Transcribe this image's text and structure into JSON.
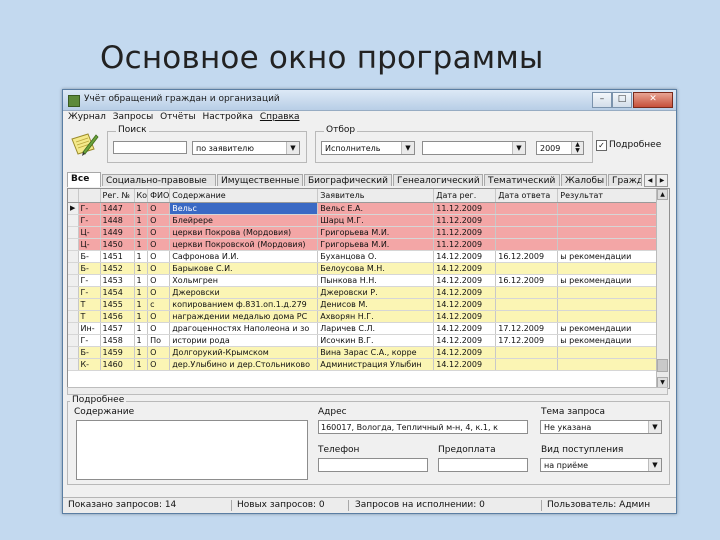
{
  "slide": {
    "title": "Основное окно программы"
  },
  "window": {
    "title": "Учёт обращений граждан и организаций",
    "controls": {
      "minimize": "–",
      "maximize": "□",
      "close": "✕"
    }
  },
  "menu": [
    "Журнал",
    "Запросы",
    "Отчёты",
    "Настройка",
    "Справка"
  ],
  "search": {
    "legend": "Поиск",
    "field_value": "",
    "mode_value": "по заявителю"
  },
  "filter": {
    "legend": "Отбор",
    "field_value": "Исполнитель",
    "value": "",
    "year": "2009",
    "detail_label": "Подробнее",
    "detail_checked": true
  },
  "tabs": [
    "Все",
    "Социально-правовые",
    "Имущественные",
    "Биографический",
    "Генеалогический",
    "Тематический",
    "Жалобы",
    "Граждане"
  ],
  "table": {
    "columns": [
      "",
      "Рег. №",
      "Ко",
      "ФИО",
      "Содержание",
      "Заявитель",
      "Дата рег.",
      "Дата ответа",
      "Результат"
    ],
    "rows": [
      {
        "marker": "▶",
        "c1": "Г-",
        "c2": "1447",
        "c3": "1",
        "c4": "О",
        "c5": "Вельс",
        "c6": "Вельс Е.А.",
        "c7": "11.12.2009",
        "c8": "",
        "c9": "",
        "color": "#f3a6a6"
      },
      {
        "marker": "",
        "c1": "Г-",
        "c2": "1448",
        "c3": "1",
        "c4": "О",
        "c5": "Блейрере",
        "c6": "Шарц М.Г.",
        "c7": "11.12.2009",
        "c8": "",
        "c9": "",
        "color": "#f3a6a6"
      },
      {
        "marker": "",
        "c1": "Ц-",
        "c2": "1449",
        "c3": "1",
        "c4": "О",
        "c5": "церкви Покрова (Мордовия)",
        "c6": "Григорьева М.И.",
        "c7": "11.12.2009",
        "c8": "",
        "c9": "",
        "color": "#f3a6a6"
      },
      {
        "marker": "",
        "c1": "Ц-",
        "c2": "1450",
        "c3": "1",
        "c4": "О",
        "c5": "церкви Покровской (Мордовия)",
        "c6": "Григорьева М.И.",
        "c7": "11.12.2009",
        "c8": "",
        "c9": "",
        "color": "#f3a6a6"
      },
      {
        "marker": "",
        "c1": "Б-",
        "c2": "1451",
        "c3": "1",
        "c4": "О",
        "c5": "Сафронова И.И.",
        "c6": "Буханцова О.",
        "c7": "14.12.2009",
        "c8": "16.12.2009",
        "c9": "ы рекомендации",
        "color": "#ffffff"
      },
      {
        "marker": "",
        "c1": "Б-",
        "c2": "1452",
        "c3": "1",
        "c4": "О",
        "c5": "Барыкове С.И.",
        "c6": "Белоусова М.Н.",
        "c7": "14.12.2009",
        "c8": "",
        "c9": "",
        "color": "#fbf5b4"
      },
      {
        "marker": "",
        "c1": "Г-",
        "c2": "1453",
        "c3": "1",
        "c4": "О",
        "c5": "Хольмгрен",
        "c6": "Пынкова Н.Н.",
        "c7": "14.12.2009",
        "c8": "16.12.2009",
        "c9": "ы рекомендации",
        "color": "#ffffff"
      },
      {
        "marker": "",
        "c1": "Г-",
        "c2": "1454",
        "c3": "1",
        "c4": "О",
        "c5": "Джеровски",
        "c6": "Джеровски Р.",
        "c7": "14.12.2009",
        "c8": "",
        "c9": "",
        "color": "#fbf5b4"
      },
      {
        "marker": "",
        "c1": "Т",
        "c2": "1455",
        "c3": "1",
        "c4": "с",
        "c5": "копированием ф.831.оп.1.д.279",
        "c6": "Денисов М.",
        "c7": "14.12.2009",
        "c8": "",
        "c9": "",
        "color": "#fbf5b4"
      },
      {
        "marker": "",
        "c1": "Т",
        "c2": "1456",
        "c3": "1",
        "c4": "О",
        "c5": "награждении медалью дома РС",
        "c6": "Ахворян Н.Г.",
        "c7": "14.12.2009",
        "c8": "",
        "c9": "",
        "color": "#fbf5b4"
      },
      {
        "marker": "",
        "c1": "Ин-",
        "c2": "1457",
        "c3": "1",
        "c4": "О",
        "c5": "драгоценностях Наполеона и зо",
        "c6": "Ларичев С.Л.",
        "c7": "14.12.2009",
        "c8": "17.12.2009",
        "c9": "ы рекомендации",
        "color": "#ffffff"
      },
      {
        "marker": "",
        "c1": "Г-",
        "c2": "1458",
        "c3": "1",
        "c4": "По",
        "c5": "истории рода",
        "c6": "Исочкин В.Г.",
        "c7": "14.12.2009",
        "c8": "17.12.2009",
        "c9": "ы рекомендации",
        "color": "#ffffff"
      },
      {
        "marker": "",
        "c1": "Б-",
        "c2": "1459",
        "c3": "1",
        "c4": "О",
        "c5": "Долгорукий-Крымском",
        "c6": "Вина Зарас С.А., корре",
        "c7": "14.12.2009",
        "c8": "",
        "c9": "",
        "color": "#fbf5b4"
      },
      {
        "marker": "",
        "c1": "К-",
        "c2": "1460",
        "c3": "1",
        "c4": "О",
        "c5": "дер.Улыбино и дер.Стольниково",
        "c6": "Администрация Улыбин",
        "c7": "14.12.2009",
        "c8": "",
        "c9": "",
        "color": "#fbf5b4"
      }
    ]
  },
  "details": {
    "legend": "Подробнее",
    "content_label": "Содержание",
    "address_label": "Адрес",
    "address_value": "160017, Вологда, Тепличный м-н, 4, к.1, к",
    "phone_label": "Телефон",
    "phone_value": "",
    "prepay_label": "Предоплата",
    "prepay_value": "",
    "topic_label": "Тема запроса",
    "topic_value": "Не указана",
    "receipt_label": "Вид поступления",
    "receipt_value": "на приёме"
  },
  "status": {
    "shown": "Показано запросов: 14",
    "new": "Новых запросов: 0",
    "in_progress": "Запросов на исполнении: 0",
    "user": "Пользователь: Админ"
  },
  "colors": {
    "row_red": "#f3a6a6",
    "row_yellow": "#fbf5b4",
    "selection": "#3a69c4",
    "background": "#c3d9ef"
  }
}
